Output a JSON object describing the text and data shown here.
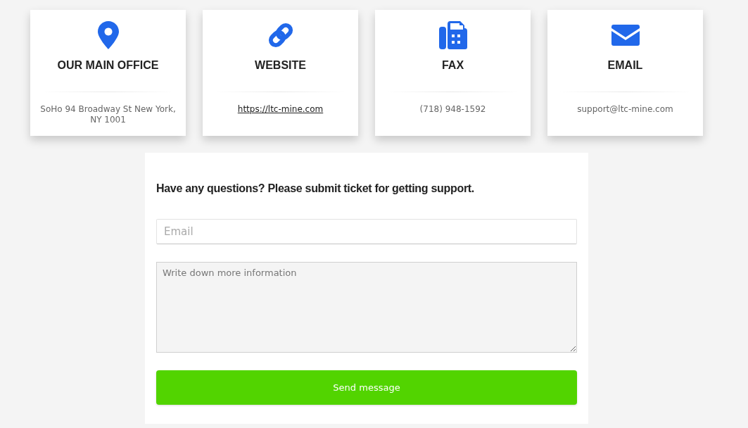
{
  "contact_cards": [
    {
      "kind": "office",
      "title": "OUR MAIN OFFICE",
      "value": "SoHo 94 Broadway St New York, NY 1001"
    },
    {
      "kind": "website",
      "title": "WEBSITE",
      "value": "https://ltc-mine.com"
    },
    {
      "kind": "fax",
      "title": "FAX",
      "value": "(718) 948-1592"
    },
    {
      "kind": "email",
      "title": "EMAIL",
      "value": "support@ltc-mine.com"
    }
  ],
  "support_form": {
    "heading": "Have any questions? Please submit ticket for getting support.",
    "email_field": {
      "placeholder": "Email"
    },
    "message_field": {
      "placeholder": "Write down more information"
    },
    "submit_button": "Send message"
  }
}
